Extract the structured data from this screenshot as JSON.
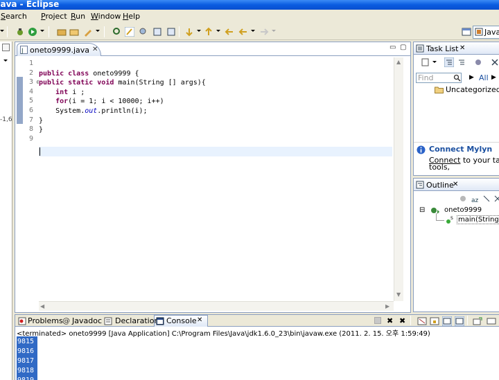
{
  "window": {
    "title": "Java - Eclipse"
  },
  "menu": {
    "items": [
      {
        "label": "Search",
        "mnemonic": "S"
      },
      {
        "label": "Project",
        "mnemonic": "P"
      },
      {
        "label": "Run",
        "mnemonic": "R"
      },
      {
        "label": "Window",
        "mnemonic": "W"
      },
      {
        "label": "Help",
        "mnemonic": "H"
      }
    ]
  },
  "perspective": {
    "label": "Java"
  },
  "left_strip": {
    "label": "-1,6"
  },
  "editor": {
    "tab_label": "oneto9999.java",
    "line_numbers": [
      "1",
      "2",
      "3",
      "4",
      "5",
      "6",
      "7",
      "8",
      "9"
    ],
    "code_lines": [
      {
        "parts": []
      },
      {
        "parts": [
          {
            "t": "public class ",
            "k": true
          },
          {
            "t": "oneto9999 {"
          }
        ]
      },
      {
        "parts": [
          {
            "t": "public static void ",
            "k": true
          },
          {
            "t": "main(String [] args){"
          }
        ]
      },
      {
        "parts": [
          {
            "t": "    "
          },
          {
            "t": "int ",
            "k": true
          },
          {
            "t": "i ;"
          }
        ]
      },
      {
        "parts": [
          {
            "t": "    "
          },
          {
            "t": "for",
            "k": true
          },
          {
            "t": "(i = 1; i < 10000; i++)"
          }
        ]
      },
      {
        "parts": [
          {
            "t": "    System."
          },
          {
            "t": "out",
            "i": true
          },
          {
            "t": ".println(i);"
          }
        ]
      },
      {
        "parts": [
          {
            "t": "}"
          }
        ]
      },
      {
        "parts": [
          {
            "t": "}"
          }
        ]
      },
      {
        "parts": []
      }
    ]
  },
  "task_list": {
    "title": "Task List",
    "find_placeholder": "Find",
    "all_label": "All",
    "category": "Uncategorized",
    "mylyn_title": "Connect Mylyn",
    "mylyn_link": "Connect",
    "mylyn_text": " to your task a",
    "mylyn_text2": "tools,"
  },
  "outline": {
    "title": "Outline",
    "class_name": "oneto9999",
    "method_name": "main(String["
  },
  "console": {
    "tabs": [
      "Problems",
      "Javadoc",
      "Declaration",
      "Console"
    ],
    "header": "<terminated> oneto9999 [Java Application] C:\\Program Files\\Java\\jdk1.6.0_23\\bin\\javaw.exe (2011. 2. 15. 오후 1:59:49)",
    "lines": [
      "9815",
      "9816",
      "9817",
      "9818",
      "9819"
    ]
  },
  "colors": {
    "keyword": "#7f0055",
    "selection": "#316ac5",
    "title_bar": "#0a5ce0"
  }
}
